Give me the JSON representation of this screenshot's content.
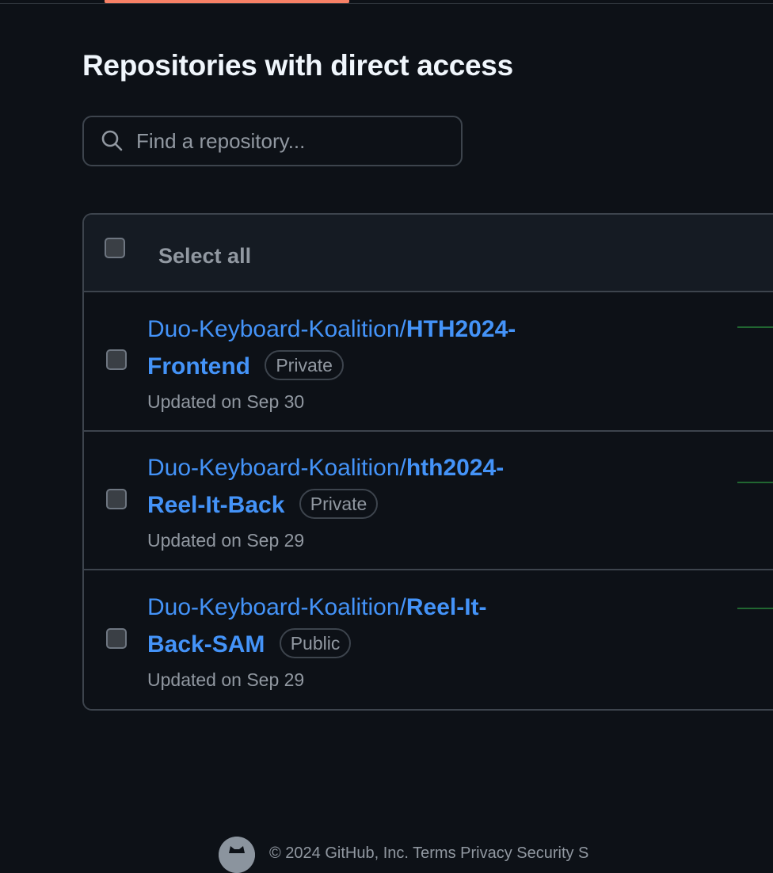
{
  "page": {
    "title": "Repositories with direct access"
  },
  "search": {
    "placeholder": "Find a repository...",
    "value": ""
  },
  "table": {
    "select_all_label": "Select all",
    "rows": [
      {
        "owner": "Duo-Keyboard-Koalition/",
        "name_part1": "HTH2024-",
        "name_part2": "Frontend",
        "visibility": "Private",
        "updated": "Updated on Sep 30"
      },
      {
        "owner": "Duo-Keyboard-Koalition/",
        "name_part1": "hth2024-",
        "name_part2": "Reel-It-Back",
        "visibility": "Private",
        "updated": "Updated on Sep 29"
      },
      {
        "owner": "Duo-Keyboard-Koalition/",
        "name_part1": "Reel-It-",
        "name_part2": "Back-SAM",
        "visibility": "Public",
        "updated": "Updated on Sep 29"
      }
    ]
  },
  "colors": {
    "background": "#0d1117",
    "link": "#4493f8",
    "muted": "#9198a1",
    "border": "#3d444d",
    "tab_accent": "#f78166",
    "activity": "#2ea043"
  },
  "footer": {
    "text": "© 2024 GitHub, Inc. Terms Privacy Security S",
    "logo_icon": "github-logo-icon"
  }
}
